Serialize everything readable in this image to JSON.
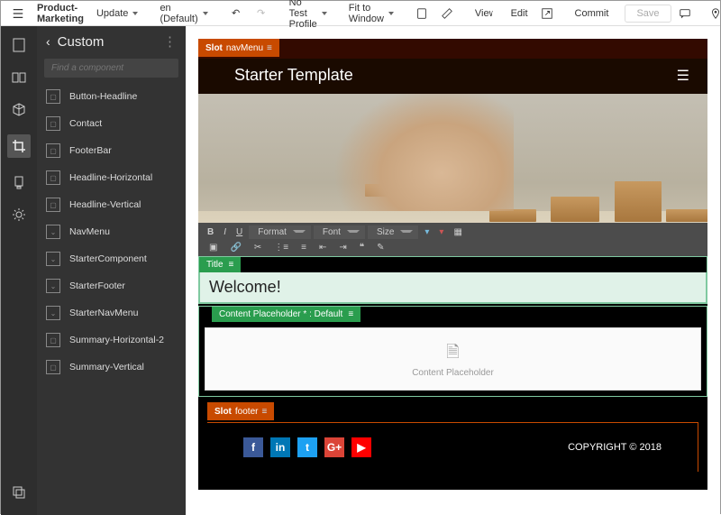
{
  "toolbar": {
    "menu_icon": "menu",
    "product_label": "Product-Marketing",
    "update_label": "Update",
    "locale_label": "en (Default)",
    "profile_label": "No Test Profile",
    "fit_label": "Fit to Window",
    "view_label": "View",
    "edit_label": "Edit",
    "commit_label": "Commit",
    "save_label": "Save"
  },
  "sidepanel": {
    "title": "Custom",
    "search_placeholder": "Find a component",
    "items": [
      {
        "label": "Button-Headline"
      },
      {
        "label": "Contact"
      },
      {
        "label": "FooterBar"
      },
      {
        "label": "Headline-Horizontal"
      },
      {
        "label": "Headline-Vertical"
      },
      {
        "label": "NavMenu"
      },
      {
        "label": "StarterComponent"
      },
      {
        "label": "StarterFooter"
      },
      {
        "label": "StarterNavMenu"
      },
      {
        "label": "Summary-Horizontal-2"
      },
      {
        "label": "Summary-Vertical"
      }
    ]
  },
  "canvas": {
    "slot_nav_label": "Slot",
    "slot_nav_name": "navMenu",
    "page_title": "Starter Template",
    "rte": {
      "format_label": "Format",
      "font_label": "Font",
      "size_label": "Size"
    },
    "title_tab": "Title",
    "title_value": "Welcome!",
    "cp_tab": "Content Placeholder  * : Default",
    "cp_body": "Content Placeholder",
    "footer_slot_label": "Slot",
    "footer_slot_name": "footer",
    "copyright": "COPYRIGHT © 2018"
  }
}
